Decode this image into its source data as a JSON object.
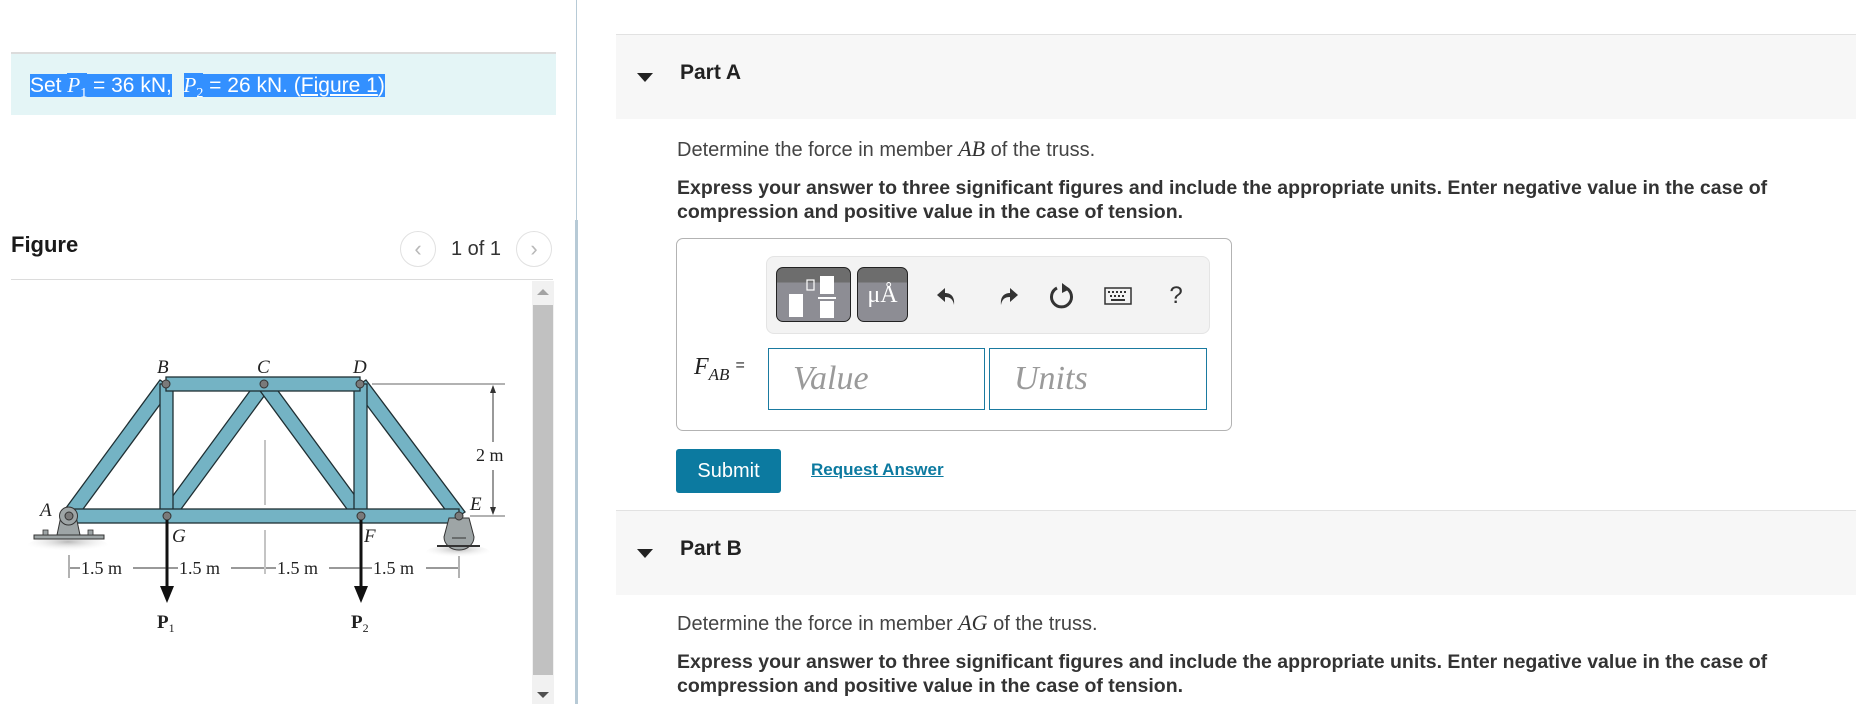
{
  "problem": {
    "statement_prefix": "Set ",
    "p1_symbol": "P",
    "p1_sub": "1",
    "p1_value": " = 36 kN,",
    "p2_symbol": "P",
    "p2_sub": "2",
    "p2_value": " = 26 kN.",
    "figure_link_open": " (",
    "figure_link": "Figure 1",
    "figure_link_close": ")"
  },
  "figure": {
    "title": "Figure",
    "page_indicator": "1 of 1",
    "prev_icon": "chevron-left-icon",
    "next_icon": "chevron-right-icon",
    "labels": {
      "A": "A",
      "B": "B",
      "C": "C",
      "D": "D",
      "E": "E",
      "F": "F",
      "G": "G",
      "height": "2 m",
      "spans": [
        "1.5 m",
        "1.5 m",
        "1.5 m",
        "1.5 m"
      ],
      "load1": "P",
      "load1_sub": "1",
      "load2": "P",
      "load2_sub": "2"
    },
    "colors": {
      "member": "#74b3c4",
      "member_stroke": "#1f2f33",
      "support": "#9ea5a6"
    }
  },
  "parts": [
    {
      "label": "Part A",
      "question_prefix": "Determine the force in member ",
      "member": "AB",
      "question_suffix": " of the truss.",
      "instructions": "Express your answer to three significant figures and include the appropriate units. Enter negative value in the case of compression and positive value in the case of tension.",
      "answer": {
        "variable": "F",
        "variable_sub": "AB",
        "equals": "=",
        "value_placeholder": "Value",
        "units_placeholder": "Units",
        "value": "",
        "units": ""
      },
      "toolbar": {
        "template_icon": "templates-icon",
        "units_button_label": "μÅ",
        "undo_icon": "undo-icon",
        "redo_icon": "redo-icon",
        "reset_icon": "reset-icon",
        "keyboard_icon": "keyboard-icon",
        "help_label": "?"
      },
      "submit_label": "Submit",
      "request_answer_label": "Request Answer"
    },
    {
      "label": "Part B",
      "question_prefix": "Determine the force in member ",
      "member": "AG",
      "question_suffix": " of the truss.",
      "instructions": "Express your answer to three significant figures and include the appropriate units. Enter negative value in the case of compression and positive value in the case of tension."
    }
  ],
  "colors": {
    "accent": "#0c7aa0",
    "info_bg": "#e4f5f6",
    "selection": "#3390ff",
    "part_header_bg": "#f7f7f7"
  }
}
